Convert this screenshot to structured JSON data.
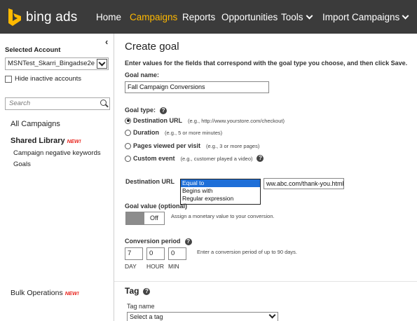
{
  "brand": {
    "name": "bing ads",
    "accent_color": "#ffb900",
    "logo_icon": "bing-logo-icon"
  },
  "nav": {
    "items": [
      {
        "label": "Home",
        "active": false
      },
      {
        "label": "Campaigns",
        "active": true
      },
      {
        "label": "Reports",
        "active": false
      },
      {
        "label": "Opportunities",
        "active": false
      },
      {
        "label": "Tools",
        "active": false,
        "has_caret": true
      },
      {
        "label": "Import Campaigns",
        "active": false,
        "has_caret": true
      }
    ],
    "background": "#3b3b3b"
  },
  "sidebar": {
    "collapse_glyph": "‹",
    "selected_account_label": "Selected Account",
    "account_value": "MSNTest_Skarri_Bingadse2e -",
    "hide_inactive_label": "Hide inactive accounts",
    "search_placeholder": "Search",
    "all_campaigns": "All Campaigns",
    "shared_library": "Shared Library",
    "new_badge": "NEW!",
    "links": [
      "Campaign negative keywords",
      "Goals"
    ],
    "bulk_operations": "Bulk Operations",
    "bulk_new_badge": "NEW!"
  },
  "form": {
    "title": "Create goal",
    "instructions": "Enter values for the fields that correspond with the goal type you choose, and then click Save.",
    "goal_name_label": "Goal name:",
    "goal_name_value": "Fall Campaign Conversions",
    "goal_type_label": "Goal type:",
    "goal_types": [
      {
        "label": "Destination URL",
        "hint": "(e.g., http://www.yourstore.com/checkout)",
        "selected": true
      },
      {
        "label": "Duration",
        "hint": "(e.g., 5 or more minutes)",
        "selected": false
      },
      {
        "label": "Pages viewed per visit",
        "hint": "(e.g., 3 or more pages)",
        "selected": false
      },
      {
        "label": "Custom event",
        "hint": "(e.g., customer played a video)",
        "selected": false
      }
    ],
    "destination_url_label": "Destination URL",
    "operator_options": [
      "Equal to",
      "Begins with",
      "Regular expression"
    ],
    "operator_selected": "Equal to",
    "destination_url_value": "ww.abc.com/thank-you.html",
    "goal_value_label": "Goal value (optional)",
    "goal_value_toggle": "Off",
    "goal_value_hint": "Assign a monetary value to your conversion.",
    "conversion_period_label": "Conversion period",
    "conversion_period": {
      "day": "7",
      "hour": "0",
      "min": "0"
    },
    "unit_labels": {
      "day": "DAY",
      "hour": "HOUR",
      "min": "MIN"
    },
    "conversion_period_hint": "Enter a conversion period of up to 90 days.",
    "tag_heading": "Tag",
    "tag_name_label": "Tag name",
    "tag_select_value": "Select a tag"
  }
}
